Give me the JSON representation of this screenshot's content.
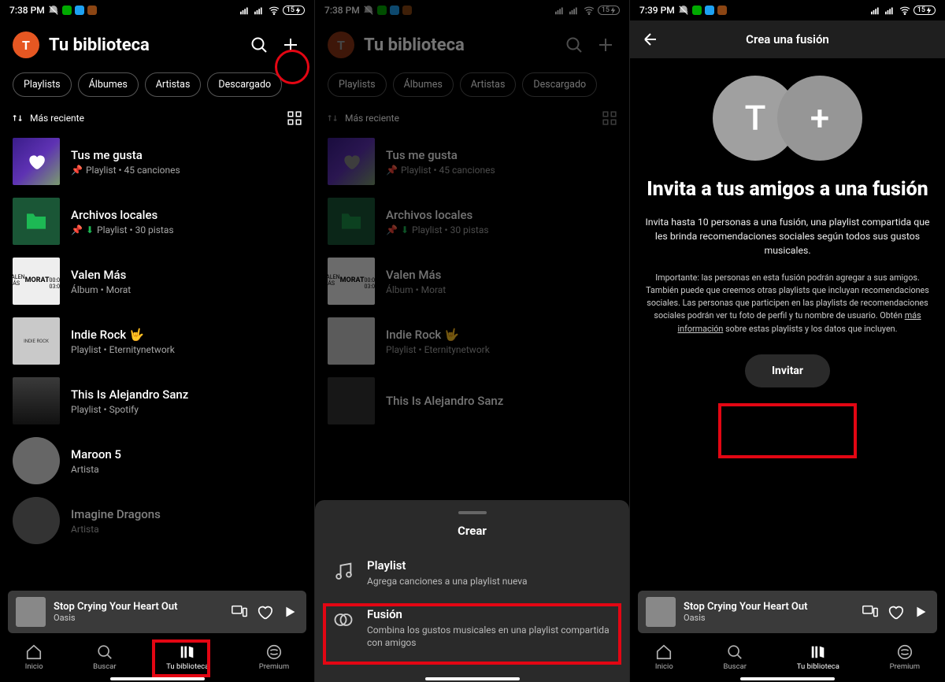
{
  "status": {
    "time1": "7:38 PM",
    "time2": "7:38 PM",
    "time3": "7:39 PM",
    "battery": "15"
  },
  "header": {
    "avatar": "T",
    "title": "Tu biblioteca"
  },
  "chips": [
    "Playlists",
    "Álbumes",
    "Artistas",
    "Descargado"
  ],
  "sort": {
    "label": "Más reciente"
  },
  "items": [
    {
      "name": "Tus me gusta",
      "sub": "Playlist • 45 canciones",
      "pinned": true,
      "thumb": "grad-heart"
    },
    {
      "name": "Archivos locales",
      "sub": "Playlist • 30 pistas",
      "pinned": true,
      "dl": true,
      "thumb": "folder"
    },
    {
      "name": "Valen Más",
      "sub": "Álbum • Morat",
      "thumb": "cover1"
    },
    {
      "name": "Indie Rock 🤟",
      "sub": "Playlist • Eternitynetwork",
      "thumb": "cover2"
    },
    {
      "name": "This Is Alejandro Sanz",
      "sub": "Playlist • Spotify",
      "thumb": "cover3"
    },
    {
      "name": "Maroon 5",
      "sub": "Artista",
      "thumb": "artist"
    },
    {
      "name": "Imagine Dragons",
      "sub": "Artista",
      "thumb": "artist"
    }
  ],
  "nowPlaying": {
    "title": "Stop Crying Your Heart Out",
    "artist": "Oasis"
  },
  "nav": {
    "home": "Inicio",
    "search": "Buscar",
    "library": "Tu biblioteca",
    "premium": "Premium"
  },
  "sheet": {
    "title": "Crear",
    "opt1": {
      "name": "Playlist",
      "desc": "Agrega canciones a una playlist nueva"
    },
    "opt2": {
      "name": "Fusión",
      "desc": "Combina los gustos musicales en una playlist compartida con amigos"
    }
  },
  "blend": {
    "header": "Crea una fusión",
    "circle1": "T",
    "circle2": "+",
    "h1": "Invita a tus amigos a una fusión",
    "p": "Invita hasta 10 personas a una fusión, una playlist compartida que les brinda recomendaciones sociales según todos sus gustos musicales.",
    "small_a": "Importante: las personas en esta fusión podrán agregar a sus amigos. También puede que creemos otras playlists que incluyan recomendaciones sociales. Las personas que participen en las playlists de recomendaciones sociales podrán ver tu foto de perfil y tu nombre de usuario. Obtén ",
    "small_link": "más información",
    "small_b": " sobre estas playlists y los datos que incluyen.",
    "invite": "Invitar"
  }
}
